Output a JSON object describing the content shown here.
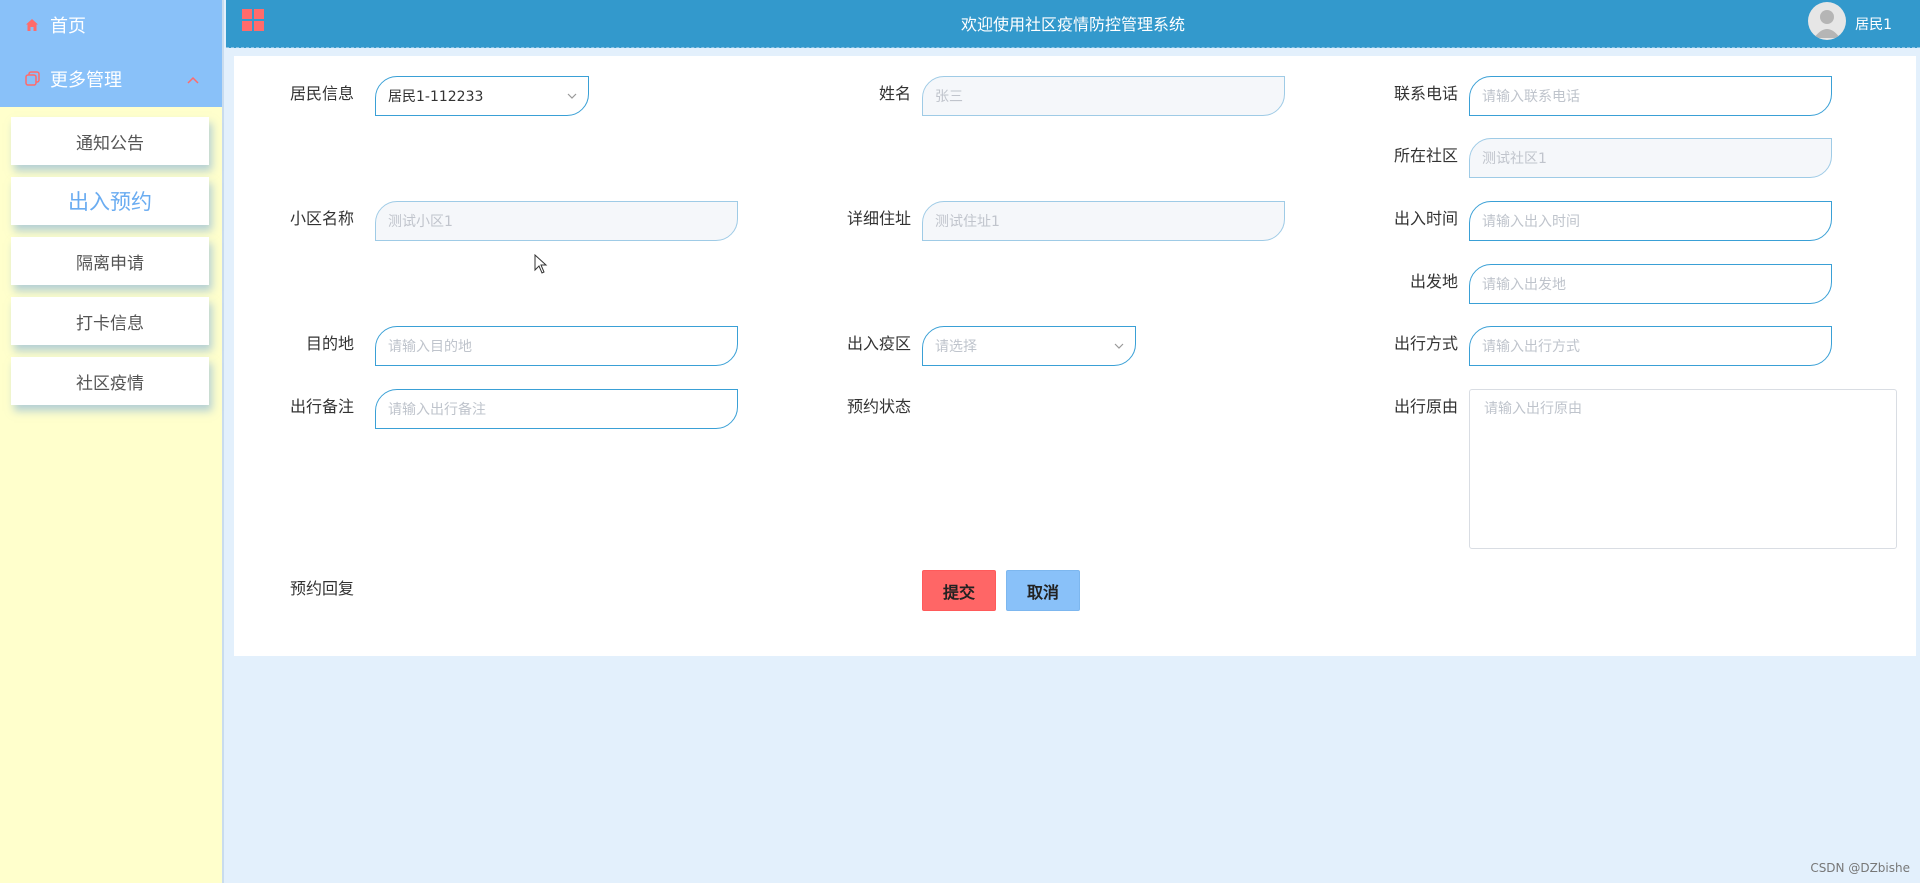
{
  "sidebar": {
    "home_label": "首页",
    "more_label": "更多管理",
    "items": [
      {
        "label": "通知公告"
      },
      {
        "label": "出入预约"
      },
      {
        "label": "隔离申请"
      },
      {
        "label": "打卡信息"
      },
      {
        "label": "社区疫情"
      }
    ],
    "colors": {
      "top_bg": "#89c1f9",
      "body_bg": "#ffffcc",
      "active_text": "#6aacf1"
    }
  },
  "topbar": {
    "title": "欢迎使用社区疫情防控管理系统",
    "user": "居民1",
    "bg_color": "#3399cc"
  },
  "form": {
    "resident_info": {
      "label": "居民信息",
      "value": "居民1-112233"
    },
    "name": {
      "label": "姓名",
      "placeholder": "张三"
    },
    "phone": {
      "label": "联系电话",
      "placeholder": "请输入联系电话"
    },
    "community": {
      "label": "所在社区",
      "placeholder": "测试社区1"
    },
    "estate": {
      "label": "小区名称",
      "placeholder": "测试小区1"
    },
    "address": {
      "label": "详细住址",
      "placeholder": "测试住址1"
    },
    "time": {
      "label": "出入时间",
      "placeholder": "请输入出入时间"
    },
    "origin": {
      "label": "出发地",
      "placeholder": "请输入出发地"
    },
    "destination": {
      "label": "目的地",
      "placeholder": "请输入目的地"
    },
    "epidemic_zone": {
      "label": "出入疫区",
      "placeholder": "请选择"
    },
    "travel_mode": {
      "label": "出行方式",
      "placeholder": "请输入出行方式"
    },
    "note": {
      "label": "出行备注",
      "placeholder": "请输入出行备注"
    },
    "status": {
      "label": "预约状态"
    },
    "reason": {
      "label": "出行原由",
      "placeholder": "请输入出行原由"
    },
    "reply": {
      "label": "预约回复"
    },
    "submit_label": "提交",
    "cancel_label": "取消"
  },
  "footer": {
    "watermark": "CSDN @DZbishe"
  }
}
